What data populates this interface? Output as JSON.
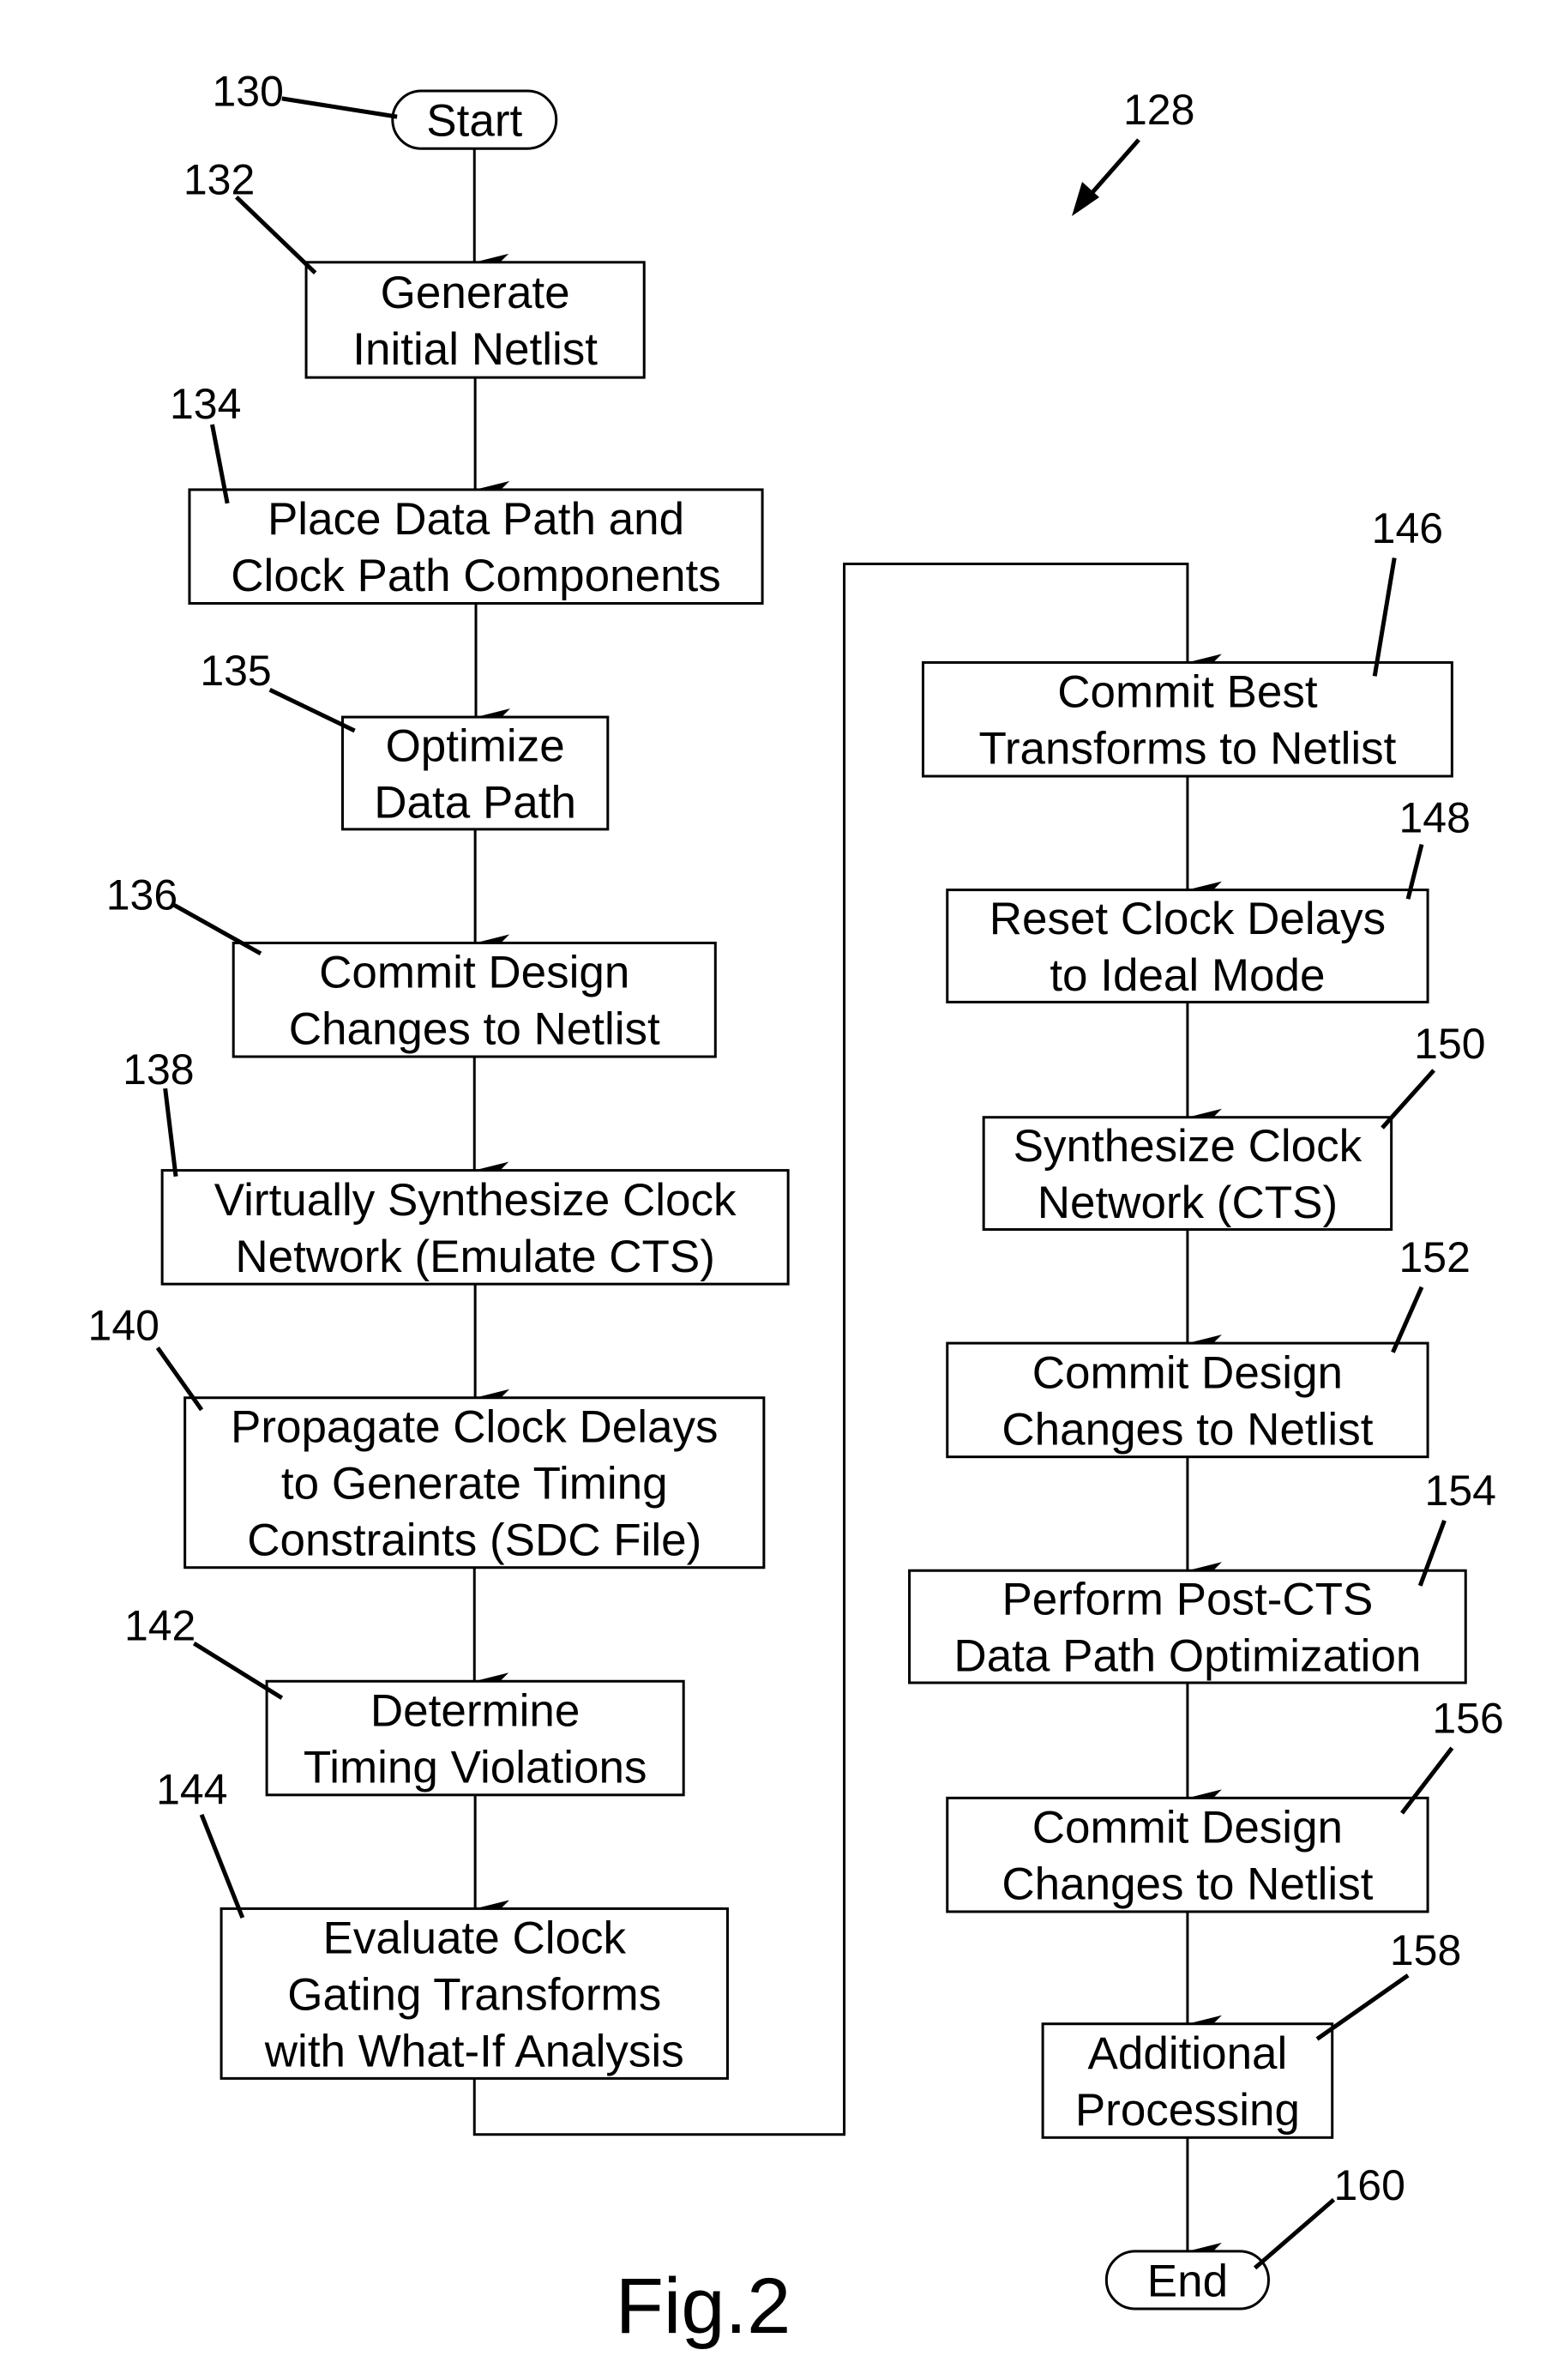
{
  "figure": {
    "label": "Fig.2",
    "reference": "128"
  },
  "nodes": [
    {
      "id": "130",
      "type": "terminal",
      "lines": [
        "Start"
      ]
    },
    {
      "id": "132",
      "type": "process",
      "lines": [
        "Generate",
        "Initial Netlist"
      ]
    },
    {
      "id": "134",
      "type": "process",
      "lines": [
        "Place Data Path and",
        "Clock Path Components"
      ]
    },
    {
      "id": "135",
      "type": "process",
      "lines": [
        "Optimize",
        "Data Path"
      ]
    },
    {
      "id": "136",
      "type": "process",
      "lines": [
        "Commit Design",
        "Changes to Netlist"
      ]
    },
    {
      "id": "138",
      "type": "process",
      "lines": [
        "Virtually Synthesize Clock",
        "Network (Emulate CTS)"
      ]
    },
    {
      "id": "140",
      "type": "process",
      "lines": [
        "Propagate Clock Delays",
        "to Generate Timing",
        "Constraints (SDC File)"
      ]
    },
    {
      "id": "142",
      "type": "process",
      "lines": [
        "Determine",
        "Timing Violations"
      ]
    },
    {
      "id": "144",
      "type": "process",
      "lines": [
        "Evaluate Clock",
        "Gating Transforms",
        "with What-If Analysis"
      ]
    },
    {
      "id": "146",
      "type": "process",
      "lines": [
        "Commit Best",
        "Transforms to Netlist"
      ]
    },
    {
      "id": "148",
      "type": "process",
      "lines": [
        "Reset Clock Delays",
        "to Ideal Mode"
      ]
    },
    {
      "id": "150",
      "type": "process",
      "lines": [
        "Synthesize Clock",
        "Network (CTS)"
      ]
    },
    {
      "id": "152",
      "type": "process",
      "lines": [
        "Commit Design",
        "Changes to Netlist"
      ]
    },
    {
      "id": "154",
      "type": "process",
      "lines": [
        "Perform Post-CTS",
        "Data Path Optimization"
      ]
    },
    {
      "id": "156",
      "type": "process",
      "lines": [
        "Commit Design",
        "Changes to Netlist"
      ]
    },
    {
      "id": "158",
      "type": "process",
      "lines": [
        "Additional",
        "Processing"
      ]
    },
    {
      "id": "160",
      "type": "terminal",
      "lines": [
        "End"
      ]
    }
  ],
  "edges": [
    [
      "130",
      "132"
    ],
    [
      "132",
      "134"
    ],
    [
      "134",
      "135"
    ],
    [
      "135",
      "136"
    ],
    [
      "136",
      "138"
    ],
    [
      "138",
      "140"
    ],
    [
      "140",
      "142"
    ],
    [
      "142",
      "144"
    ],
    [
      "144",
      "146"
    ],
    [
      "146",
      "148"
    ],
    [
      "148",
      "150"
    ],
    [
      "150",
      "152"
    ],
    [
      "152",
      "154"
    ],
    [
      "154",
      "156"
    ],
    [
      "156",
      "158"
    ],
    [
      "158",
      "160"
    ]
  ]
}
